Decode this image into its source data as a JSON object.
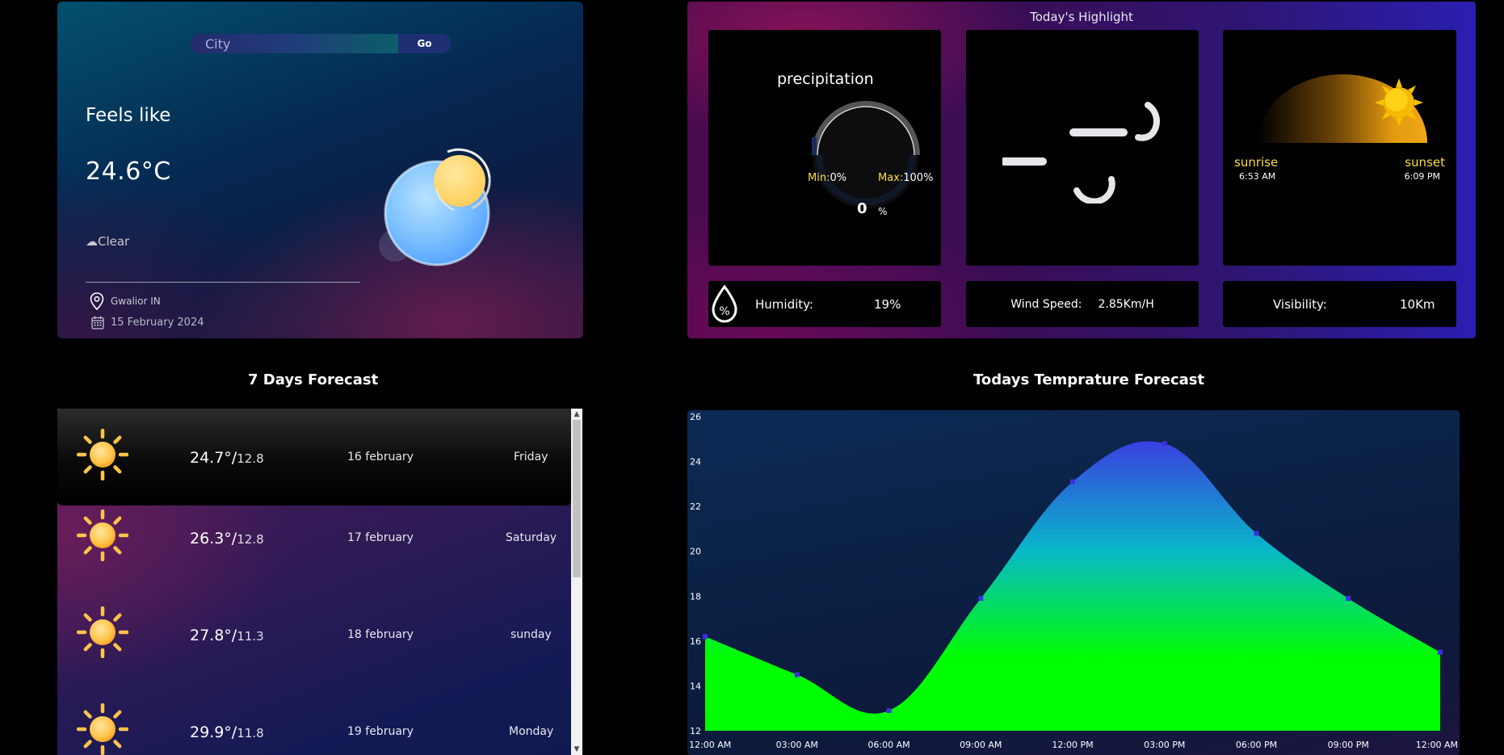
{
  "search": {
    "placeholder": "City",
    "button_label": "Go"
  },
  "current": {
    "feels_label": "Feels like",
    "temperature": "24.6°C",
    "condition": "☁Clear",
    "location": "Gwalior IN",
    "date": "15 February 2024"
  },
  "highlights": {
    "title": "Today's Highlight",
    "precipitation": {
      "title": "precipitation",
      "min_label": "Min:",
      "min_value": "0%",
      "max_label": "Max:",
      "max_value": "100%",
      "value": "0",
      "unit": "%"
    },
    "sun": {
      "sunrise_label": "sunrise",
      "sunrise_time": "6:53 AM",
      "sunset_label": "sunset",
      "sunset_time": "6:09 PM"
    },
    "humidity": {
      "label": "Humidity:",
      "value": "19%"
    },
    "wind": {
      "label": "Wind Speed:",
      "value": "2.85Km/H"
    },
    "visibility": {
      "label": "Visibility:",
      "value": "10Km"
    }
  },
  "forecast": {
    "title": "7 Days Forecast",
    "days": [
      {
        "high": "24.7°/",
        "low": "12.8",
        "date": "16 february",
        "day": "Friday",
        "icon": "sun-icon"
      },
      {
        "high": "26.3°/",
        "low": "12.8",
        "date": "17 february",
        "day": "Saturday",
        "icon": "sun-icon"
      },
      {
        "high": "27.8°/",
        "low": "11.3",
        "date": "18 february",
        "day": "sunday",
        "icon": "sun-icon"
      },
      {
        "high": "29.9°/",
        "low": "11.8",
        "date": "19 february",
        "day": "Monday",
        "icon": "sun-icon"
      }
    ]
  },
  "colors": {
    "accent_yellow": "#ffde3d",
    "chart_fill_top": "#3a3fe0",
    "chart_fill_mid": "#08b8c8",
    "chart_fill_bottom": "#00ff00",
    "chart_point": "#3d2fe0"
  },
  "chart_title": "Todays Temprature Forecast",
  "chart_data": {
    "type": "area",
    "title": "",
    "xlabel": "",
    "ylabel": "",
    "x": [
      "12:00 AM",
      "03:00 AM",
      "06:00 AM",
      "09:00 AM",
      "12:00 PM",
      "03:00 PM",
      "06:00 PM",
      "09:00 PM",
      "12:00 AM"
    ],
    "series": [
      {
        "values": [
          16.2,
          14.5,
          12.9,
          17.9,
          23.1,
          24.8,
          20.8,
          17.9,
          15.5
        ]
      }
    ],
    "ylim": [
      12,
      26
    ],
    "yticks": [
      12,
      14,
      16,
      18,
      20,
      22,
      24,
      26
    ],
    "grid": false,
    "legend": "none"
  }
}
